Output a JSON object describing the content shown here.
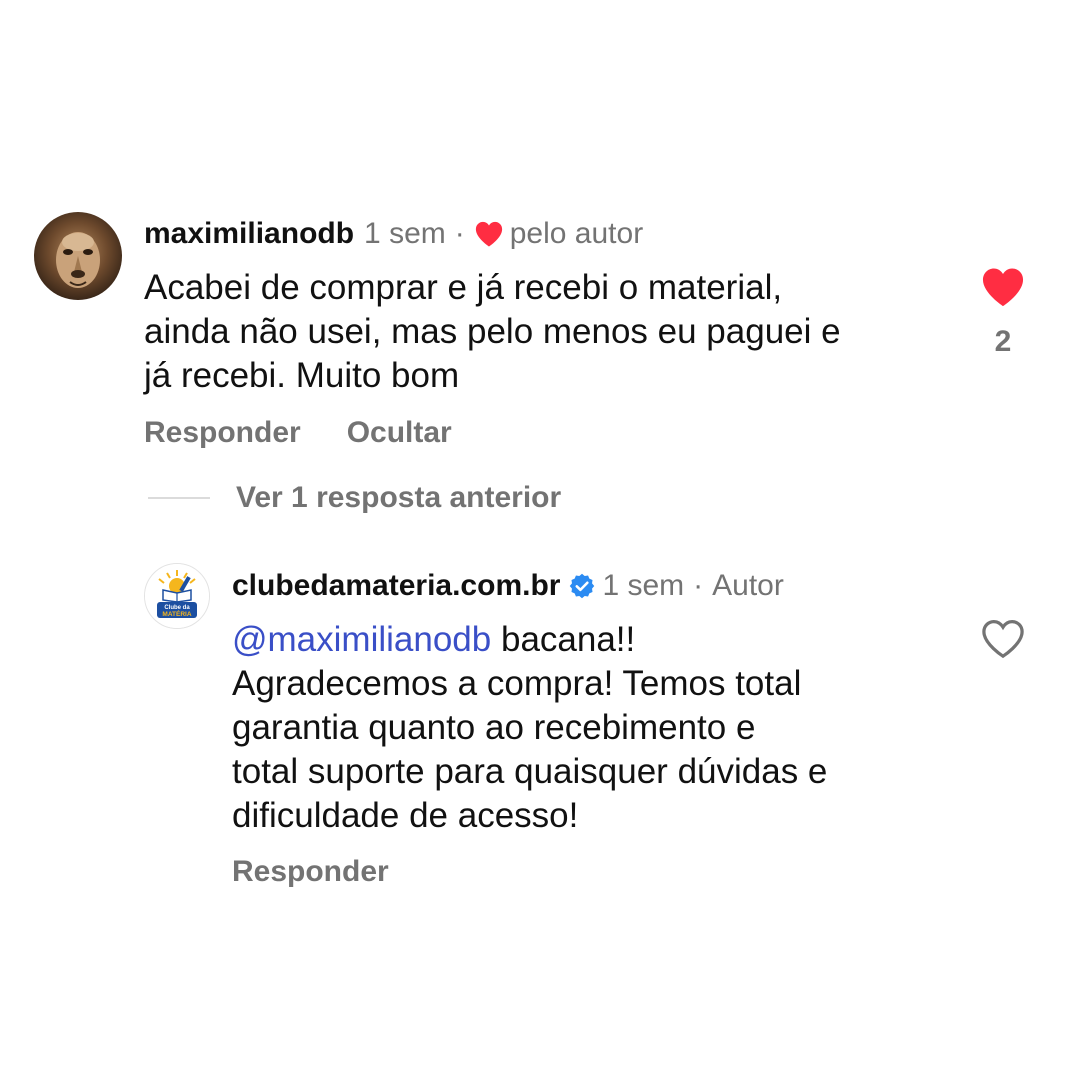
{
  "colors": {
    "text": "#111111",
    "muted": "#737373",
    "mention": "#3a4fc7",
    "like_red": "#ff2d42",
    "verified_blue": "#2b8bf2"
  },
  "comment": {
    "username": "maximilianodb",
    "time": "1 sem",
    "liked_by_author_label": "pelo autor",
    "text": "Acabei de comprar e já recebi o material,\nainda não usei, mas pelo menos eu paguei e\njá recebi. Muito bom",
    "like_count": "2",
    "liked": true,
    "actions": {
      "reply_label": "Responder",
      "hide_label": "Ocultar"
    },
    "avatar_icon": "lion-avatar-icon"
  },
  "view_replies_label": "Ver 1 resposta anterior",
  "reply": {
    "username": "clubedamateria.com.br",
    "verified": true,
    "time": "1 sem",
    "role_label": "Autor",
    "mention": "@maximilianodb",
    "text_after_mention": " bacana!!",
    "text": "Agradecemos a compra! Temos total\ngarantia quanto ao recebimento e\ntotal suporte para quaisquer dúvidas e\ndificuldade de acesso!",
    "liked": false,
    "actions": {
      "reply_label": "Responder"
    },
    "avatar_logo": {
      "line1": "Clube da",
      "line2": "MATÉRIA"
    }
  }
}
